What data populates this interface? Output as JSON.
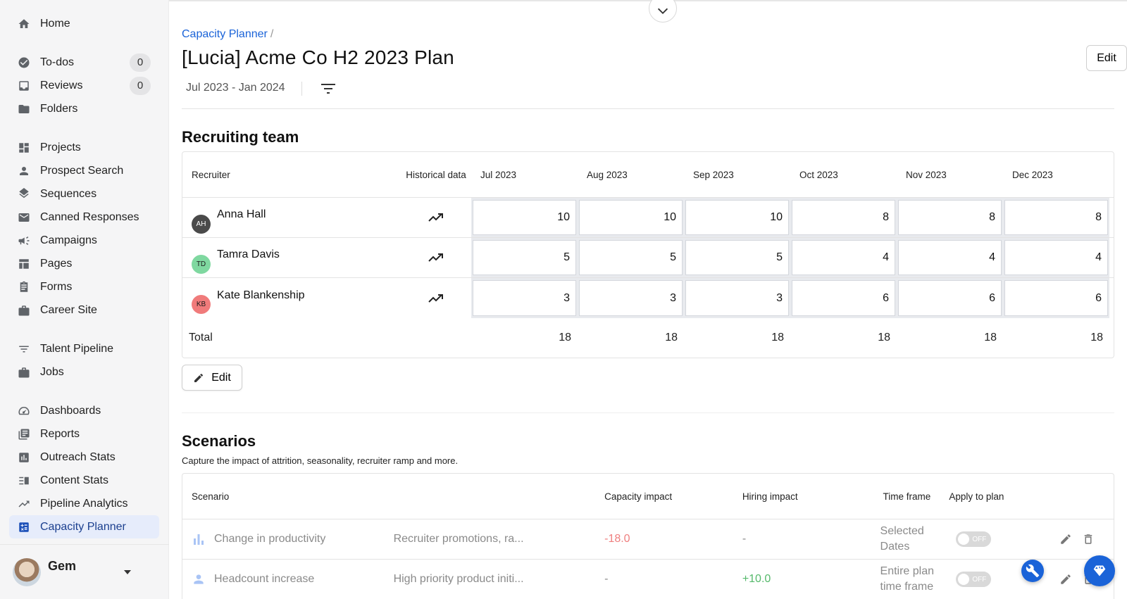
{
  "sidebar": {
    "groups": [
      [
        {
          "label": "Home",
          "icon": "home-icon"
        }
      ],
      [
        {
          "label": "To-dos",
          "icon": "check-circle-icon",
          "count": "0"
        },
        {
          "label": "Reviews",
          "icon": "inbox-icon",
          "count": "0"
        },
        {
          "label": "Folders",
          "icon": "folder-icon"
        }
      ],
      [
        {
          "label": "Projects",
          "icon": "dashboard-grid-icon"
        },
        {
          "label": "Prospect Search",
          "icon": "person-icon"
        },
        {
          "label": "Sequences",
          "icon": "layers-icon"
        },
        {
          "label": "Canned Responses",
          "icon": "mail-icon"
        },
        {
          "label": "Campaigns",
          "icon": "megaphone-icon"
        },
        {
          "label": "Pages",
          "icon": "pages-icon"
        },
        {
          "label": "Forms",
          "icon": "clipboard-icon"
        },
        {
          "label": "Career Site",
          "icon": "briefcase-icon"
        }
      ],
      [
        {
          "label": "Talent Pipeline",
          "icon": "filter-lines-icon"
        },
        {
          "label": "Jobs",
          "icon": "briefcase-icon"
        }
      ],
      [
        {
          "label": "Dashboards",
          "icon": "speedometer-icon"
        },
        {
          "label": "Reports",
          "icon": "report-icon"
        },
        {
          "label": "Outreach Stats",
          "icon": "bar-chart-icon"
        },
        {
          "label": "Content Stats",
          "icon": "content-list-icon"
        },
        {
          "label": "Pipeline Analytics",
          "icon": "trend-line-icon"
        },
        {
          "label": "Capacity Planner",
          "icon": "calculator-icon",
          "active": true
        }
      ]
    ],
    "user": {
      "name": "Gem"
    }
  },
  "header": {
    "breadcrumb": "Capacity Planner",
    "breadcrumb_sep": "/",
    "title": "[Lucia] Acme Co H2 2023 Plan",
    "edit_label": "Edit",
    "date_range": "Jul 2023 - Jan 2024"
  },
  "recruiting": {
    "title": "Recruiting team",
    "headers": {
      "recruiter": "Recruiter",
      "historical": "Historical data",
      "months": [
        "Jul 2023",
        "Aug 2023",
        "Sep 2023",
        "Oct 2023",
        "Nov 2023",
        "Dec 2023"
      ]
    },
    "rows": [
      {
        "initials": "AH",
        "name": "Anna Hall",
        "color": "#4a4a4a",
        "text_color": "#ffffff",
        "values": [
          "10",
          "10",
          "10",
          "8",
          "8",
          "8"
        ]
      },
      {
        "initials": "TD",
        "name": "Tamra Davis",
        "color": "#7fd8a0",
        "text_color": "#1b1b1b",
        "values": [
          "5",
          "5",
          "5",
          "4",
          "4",
          "4"
        ]
      },
      {
        "initials": "KB",
        "name": "Kate Blankenship",
        "color": "#f07b7b",
        "text_color": "#1b1b1b",
        "values": [
          "3",
          "3",
          "3",
          "6",
          "6",
          "6"
        ]
      }
    ],
    "total_label": "Total",
    "totals": [
      "18",
      "18",
      "18",
      "18",
      "18",
      "18"
    ],
    "edit_label": "Edit"
  },
  "scenarios": {
    "title": "Scenarios",
    "subtitle": "Capture the impact of attrition, seasonality, recruiter ramp and more.",
    "headers": {
      "scenario": "Scenario",
      "capacity": "Capacity impact",
      "hiring": "Hiring impact",
      "timeframe": "Time frame",
      "apply": "Apply to plan"
    },
    "rows": [
      {
        "icon": "bar-chart-icon",
        "name": "Change in productivity",
        "desc": "Recruiter promotions, ra...",
        "capacity": "-18.0",
        "hiring": "-",
        "timeframe": "Selected Dates",
        "toggle": "OFF"
      },
      {
        "icon": "person-icon",
        "name": "Headcount increase",
        "desc": "High priority product initi...",
        "capacity": "-",
        "hiring": "+10.0",
        "timeframe": "Entire plan time frame",
        "toggle": "OFF"
      }
    ]
  }
}
